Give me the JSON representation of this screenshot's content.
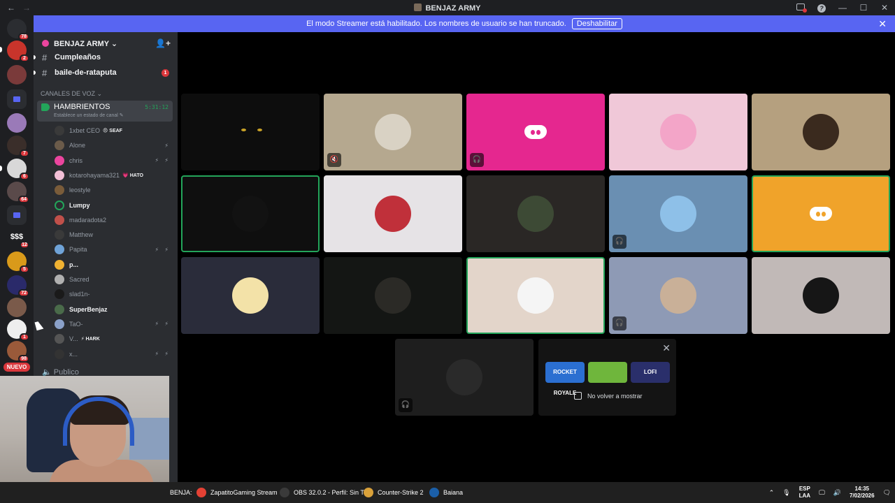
{
  "window": {
    "title": "BENJAZ ARMY",
    "back": "←",
    "forward": "→",
    "minimize": "—",
    "maximize": "☐",
    "close": "✕"
  },
  "banner": {
    "text": "El modo Streamer está habilitado. Los nombres de usuario se han truncado.",
    "button": "Deshabilitar",
    "close": "✕"
  },
  "rail": {
    "badges": [
      "78",
      "2",
      "7",
      "6",
      "64",
      "12",
      "5",
      "72",
      "1",
      "98"
    ],
    "dollar": "$$$",
    "nuevo": "NUEVO"
  },
  "sidebar": {
    "server_name": "BENJAZ ARMY ⌄",
    "add_member_icon": "👤+",
    "channels": [
      {
        "name": "Cumpleaños",
        "unread": ""
      },
      {
        "name": "baile-de-rataputa",
        "unread": "1"
      }
    ],
    "voice_category": "CANALES DE VOZ ⌄",
    "voice_channel": {
      "name": "HAMBRIENTOS",
      "status": "Establece un estado de canal ✎",
      "time": "5:31:12"
    },
    "members": [
      {
        "name": "1xbet CEO",
        "tag": "😠 SEAF",
        "mic": "",
        "active": false,
        "color": "#3a3a3a"
      },
      {
        "name": "Alone",
        "tag": "",
        "mic": "⚡",
        "active": false,
        "color": "#6b5b4a"
      },
      {
        "name": "chris",
        "tag": "",
        "mic": "⚡ ⚡",
        "active": false,
        "color": "#eb459e"
      },
      {
        "name": "kotarohayama321",
        "tag": "💗 HATO",
        "mic": "",
        "active": false,
        "color": "#f2bfd6"
      },
      {
        "name": "leostyle",
        "tag": "",
        "mic": "",
        "active": false,
        "color": "#7a5c3a"
      },
      {
        "name": "Lumpy",
        "tag": "",
        "mic": "",
        "active": true,
        "color": "#2b2d31"
      },
      {
        "name": "madaradota2",
        "tag": "",
        "mic": "",
        "active": false,
        "color": "#c0504a"
      },
      {
        "name": "Matthew",
        "tag": "",
        "mic": "",
        "active": false,
        "color": "#3a3a3a"
      },
      {
        "name": "Papita",
        "tag": "",
        "mic": "⚡ ⚡",
        "active": false,
        "color": "#6fa3d8"
      },
      {
        "name": "p...",
        "tag": "",
        "mic": "",
        "active": true,
        "color": "#f0b232"
      },
      {
        "name": "Sacred",
        "tag": "",
        "mic": "",
        "active": false,
        "color": "#b0b0b0"
      },
      {
        "name": "slad1n-",
        "tag": "",
        "mic": "",
        "active": false,
        "color": "#1a1a1a"
      },
      {
        "name": "SuperBenjaz",
        "tag": "",
        "mic": "",
        "active": true,
        "color": "#4a6b4a"
      },
      {
        "name": "TaO-",
        "tag": "",
        "mic": "⚡ ⚡",
        "active": false,
        "color": "#8aa0c8"
      },
      {
        "name": "V...",
        "tag": "⚡ HARK",
        "mic": "",
        "active": false,
        "color": "#555"
      },
      {
        "name": "x...",
        "tag": "",
        "mic": "⚡ ⚡",
        "active": false,
        "color": "#333"
      }
    ],
    "other_channel": "Publico"
  },
  "grid": [
    {
      "bg": "#0d0d0d",
      "avatar": "eyes",
      "avatar_color": "",
      "icon": "",
      "speaking": false
    },
    {
      "bg": "#b5a88f",
      "avatar": "circle",
      "avatar_color": "#d9d2c4",
      "icon": "🔇",
      "speaking": false
    },
    {
      "bg": "#e5278f",
      "avatar": "discord",
      "avatar_color": "#e5278f",
      "icon": "🎧",
      "speaking": false
    },
    {
      "bg": "#f0c8d8",
      "avatar": "circle",
      "avatar_color": "#f3a5c8",
      "icon": "",
      "speaking": false
    },
    {
      "bg": "#b5a07f",
      "avatar": "circle",
      "avatar_color": "#3a2a1e",
      "icon": "",
      "speaking": false
    },
    {
      "bg": "#0f0f0f",
      "avatar": "circle",
      "avatar_color": "#121212",
      "icon": "",
      "speaking": true
    },
    {
      "bg": "#e6e3e6",
      "avatar": "circle",
      "avatar_color": "#c0303a",
      "icon": "",
      "speaking": false
    },
    {
      "bg": "#2a2725",
      "avatar": "circle",
      "avatar_color": "#3d4a35",
      "icon": "",
      "speaking": false
    },
    {
      "bg": "#6a8fb2",
      "avatar": "circle",
      "avatar_color": "#8ec0e8",
      "icon": "🎧",
      "speaking": false
    },
    {
      "bg": "#f0a32a",
      "avatar": "discord",
      "avatar_color": "#f0a32a",
      "icon": "",
      "speaking": true
    },
    {
      "bg": "#2a2c3a",
      "avatar": "circle",
      "avatar_color": "#f3e2a8",
      "icon": "",
      "speaking": false
    },
    {
      "bg": "#141614",
      "avatar": "circle",
      "avatar_color": "#2b2a26",
      "icon": "",
      "speaking": false
    },
    {
      "bg": "#e3d5ca",
      "avatar": "circle",
      "avatar_color": "#f5f5f5",
      "icon": "",
      "speaking": true
    },
    {
      "bg": "#8e9ab5",
      "avatar": "circle",
      "avatar_color": "#c9b098",
      "icon": "🎧",
      "speaking": false
    },
    {
      "bg": "#c1b9b7",
      "avatar": "circle",
      "avatar_color": "#161616",
      "icon": "",
      "speaking": false
    },
    {
      "bg": "#1e1e1e",
      "avatar": "circle",
      "avatar_color": "#2a2a2a",
      "icon": "🎧",
      "speaking": false
    }
  ],
  "activity": {
    "close": "✕",
    "games": [
      {
        "label": "ROCKET ROYALE",
        "color": "#2b6fd1"
      },
      {
        "label": "",
        "color": "#6fb63c"
      },
      {
        "label": "LOFI",
        "color": "#2a2f6b"
      }
    ],
    "checkbox_label": "No volver a mostrar"
  },
  "taskbar": {
    "items": [
      {
        "label": "BENJA:",
        "icon_color": ""
      },
      {
        "label": "ZapatitoGaming Stream",
        "icon_color": "#e44134"
      },
      {
        "label": "OBS 32.0.2 - Perfil: Sin T",
        "icon_color": "#3a3a3a"
      },
      {
        "label": "Counter-Strike 2",
        "icon_color": "#d9a13a"
      },
      {
        "label": "Baiana",
        "icon_color": "#1b5fa8"
      }
    ],
    "tray": {
      "chevron": "⌃",
      "mic": "🎙",
      "lang_top": "ESP",
      "lang_bottom": "LAA",
      "screen": "🖵",
      "speaker": "🔊",
      "time": "14:35",
      "date": "7/02/2026",
      "notif": "🗨"
    }
  }
}
